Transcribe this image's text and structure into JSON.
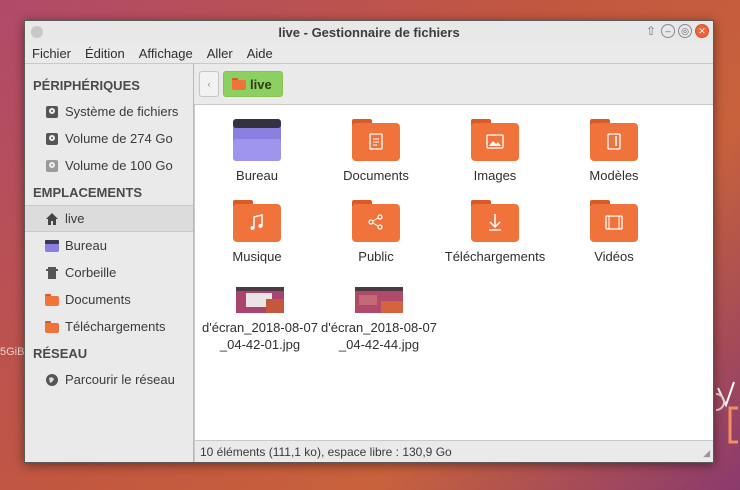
{
  "desktop": {
    "edge_text": "5GiB"
  },
  "window": {
    "title": "live - Gestionnaire de fichiers",
    "controls": {
      "up": "⇧",
      "minimize": "–",
      "maximize": "◎",
      "close": "✕"
    }
  },
  "menubar": [
    "Fichier",
    "Édition",
    "Affichage",
    "Aller",
    "Aide"
  ],
  "sidebar": {
    "devices_heading": "PÉRIPHÉRIQUES",
    "devices": [
      {
        "label": "Système de fichiers",
        "icon": "drive-icon"
      },
      {
        "label": "Volume de 274 Go",
        "icon": "drive-icon"
      },
      {
        "label": "Volume de 100 Go",
        "icon": "drive-icon"
      }
    ],
    "places_heading": "EMPLACEMENTS",
    "places": [
      {
        "label": "live",
        "icon": "home-icon"
      },
      {
        "label": "Bureau",
        "icon": "desktop-folder-icon"
      },
      {
        "label": "Corbeille",
        "icon": "trash-icon"
      },
      {
        "label": "Documents",
        "icon": "folder-icon"
      },
      {
        "label": "Téléchargements",
        "icon": "folder-icon"
      }
    ],
    "network_heading": "RÉSEAU",
    "network": [
      {
        "label": "Parcourir le réseau",
        "icon": "network-icon"
      }
    ]
  },
  "pathbar": {
    "current": "live",
    "back_glyph": "‹"
  },
  "files": [
    {
      "label": "Bureau",
      "type": "desktop-folder"
    },
    {
      "label": "Documents",
      "type": "documents-folder"
    },
    {
      "label": "Images",
      "type": "pictures-folder"
    },
    {
      "label": "Modèles",
      "type": "templates-folder"
    },
    {
      "label": "Musique",
      "type": "music-folder"
    },
    {
      "label": "Public",
      "type": "public-folder"
    },
    {
      "label": "Téléchargements",
      "type": "downloads-folder"
    },
    {
      "label": "Vidéos",
      "type": "videos-folder"
    },
    {
      "label_line1": "d'écran_2018-08-07",
      "label_line2": "_04-42-01.jpg",
      "type": "image"
    },
    {
      "label_line1": "d'écran_2018-08-07",
      "label_line2": "_04-42-44.jpg",
      "type": "image"
    }
  ],
  "statusbar": {
    "text": "10 éléments (111,1 ko), espace libre : 130,9 Go"
  },
  "colors": {
    "folder": "#f0733c",
    "folder_tab": "#d95a28",
    "accent_green": "#8cd160",
    "close": "#f0643c"
  }
}
